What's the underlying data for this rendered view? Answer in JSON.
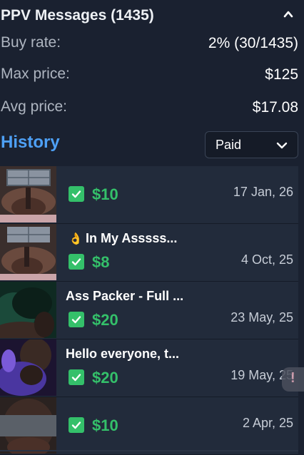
{
  "header": {
    "title": "PPV Messages (1435)",
    "collapse_icon": "chevron-up-icon"
  },
  "stats": [
    {
      "label": "Buy rate:",
      "value": "2% (30/1435)"
    },
    {
      "label": "Max price:",
      "value": "$125"
    },
    {
      "label": "Avg price:",
      "value": "$17.08"
    }
  ],
  "history": {
    "title": "History",
    "filter": {
      "selected": "Paid",
      "icon": "chevron-down-icon"
    }
  },
  "items": [
    {
      "name": "",
      "price": "$10",
      "date": "17 Jan, 26",
      "status_icon": "checkbox-checked-icon"
    },
    {
      "name": "In My Asssss...",
      "price": "$8",
      "date": "4 Oct, 25",
      "status_icon": "checkbox-checked-icon",
      "emoji": "ok-hand-icon"
    },
    {
      "name": "Ass Packer - Full ...",
      "price": "$20",
      "date": "23 May, 25",
      "status_icon": "checkbox-checked-icon"
    },
    {
      "name": "Hello everyone, t...",
      "price": "$20",
      "date": "19 May, 25",
      "status_icon": "checkbox-checked-icon"
    },
    {
      "name": "",
      "price": "$10",
      "date": "2 Apr, 25",
      "status_icon": "checkbox-checked-icon"
    }
  ],
  "side_button": {
    "text": "!"
  },
  "colors": {
    "accent": "#4ea0f5",
    "success": "#34c06a",
    "background": "#1a2130",
    "row": "#222b3b"
  }
}
